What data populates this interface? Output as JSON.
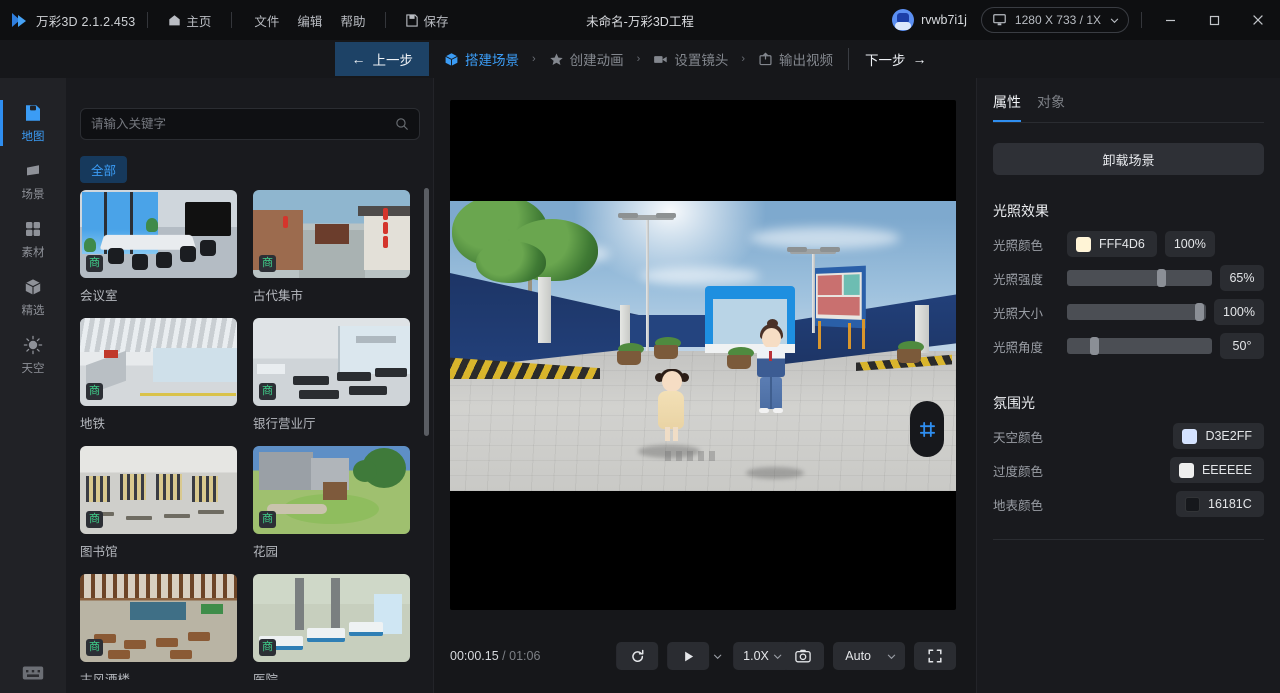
{
  "titlebar": {
    "app_name": "万彩3D 2.1.2.453",
    "home": "主页",
    "menus": [
      "文件",
      "编辑",
      "帮助"
    ],
    "save": "保存",
    "doc_title": "未命名-万彩3D工程",
    "username": "rvwb7i1j",
    "resolution": "1280 X 733 / 1X",
    "minimize": "−",
    "maximize": "□",
    "close": "✕"
  },
  "stepbar": {
    "prev": "上一步",
    "next": "下一步",
    "steps": [
      {
        "label": "搭建场景",
        "icon": "cube-icon",
        "active": true
      },
      {
        "label": "创建动画",
        "icon": "star-icon",
        "active": false
      },
      {
        "label": "设置镜头",
        "icon": "camera-icon",
        "active": false
      },
      {
        "label": "输出视频",
        "icon": "export-icon",
        "active": false
      }
    ],
    "separator": "›"
  },
  "rail": {
    "items": [
      {
        "label": "地图",
        "icon": "map-icon",
        "active": true
      },
      {
        "label": "场景",
        "icon": "scene-icon",
        "active": false
      },
      {
        "label": "素材",
        "icon": "assets-icon",
        "active": false
      },
      {
        "label": "精选",
        "icon": "featured-cube-icon",
        "active": false
      },
      {
        "label": "天空",
        "icon": "sun-icon",
        "active": false
      }
    ],
    "bottom_icon": "keyboard-icon"
  },
  "library": {
    "search_placeholder": "请输入关键字",
    "search_value": "",
    "chips": [
      "全部"
    ],
    "badge": "商",
    "items": [
      {
        "label": "会议室",
        "thumb": "t-meeting"
      },
      {
        "label": "古代集市",
        "thumb": "t-market"
      },
      {
        "label": "地铁",
        "thumb": "t-subway"
      },
      {
        "label": "银行营业厅",
        "thumb": "t-bank"
      },
      {
        "label": "图书馆",
        "thumb": "t-library"
      },
      {
        "label": "花园",
        "thumb": "t-garden"
      },
      {
        "label": "古风酒楼",
        "thumb": "t-tavern"
      },
      {
        "label": "医院",
        "thumb": "t-hosp"
      }
    ]
  },
  "player": {
    "current_time": "00:00.15",
    "separator": "/",
    "total_time": "01:06",
    "loop_icon": "loop-icon",
    "play_icon": "play-icon",
    "speed": "1.0X",
    "snapshot_icon": "camera-snapshot-icon",
    "quality": "Auto",
    "fullscreen_icon": "fullscreen-icon"
  },
  "viewport": {
    "hud_icon": "transform-grid-icon"
  },
  "props": {
    "tabs": [
      {
        "label": "属性",
        "active": true
      },
      {
        "label": "对象",
        "active": false
      }
    ],
    "unload_button": "卸载场景",
    "sections": [
      {
        "title": "光照效果",
        "rows": [
          {
            "label": "光照颜色",
            "type": "color",
            "hex": "FFF4D6",
            "swatch": "#FFF4D6",
            "value": "100%"
          },
          {
            "label": "光照强度",
            "type": "slider",
            "percent": 65,
            "value": "65%"
          },
          {
            "label": "光照大小",
            "type": "slider",
            "percent": 100,
            "value": "100%"
          },
          {
            "label": "光照角度",
            "type": "slider",
            "percent": 18,
            "value": "50°"
          }
        ]
      },
      {
        "title": "氛围光",
        "rows": [
          {
            "label": "天空颜色",
            "type": "color",
            "hex": "D3E2FF",
            "swatch": "#D3E2FF"
          },
          {
            "label": "过度颜色",
            "type": "color",
            "hex": "EEEEEE",
            "swatch": "#EEEEEE"
          },
          {
            "label": "地表颜色",
            "type": "color",
            "hex": "16181C",
            "swatch": "#16181C"
          }
        ]
      }
    ]
  },
  "colors": {
    "accent": "#2f8ef0",
    "panel_bg": "#191a1e",
    "titlebar_bg": "#0e0f11",
    "rail_bg": "#212226",
    "step_active_bg": "#1d4266"
  }
}
